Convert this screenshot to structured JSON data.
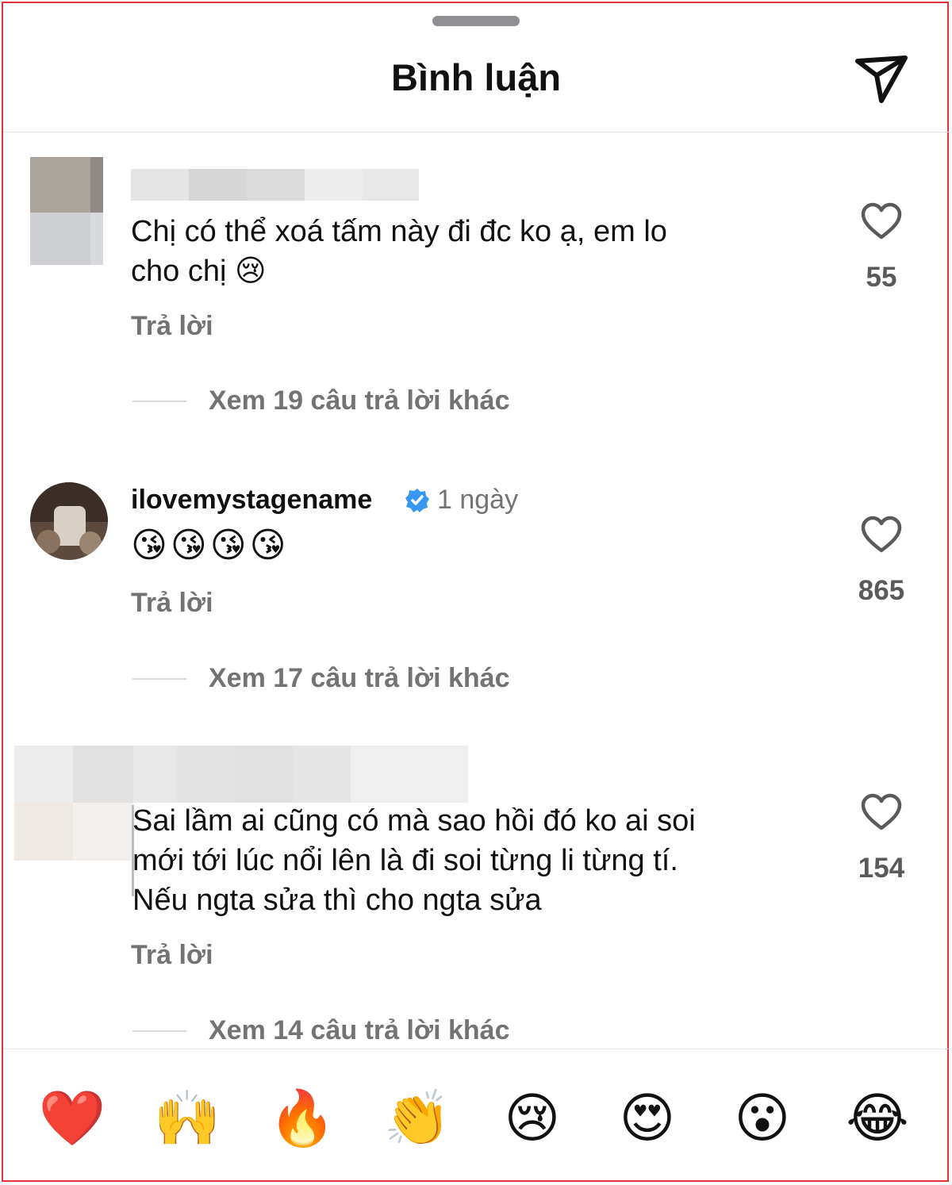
{
  "header": {
    "title": "Bình luận",
    "send_icon": "paper-plane-icon"
  },
  "comments": [
    {
      "username": "",
      "time": "",
      "text": "Chị có thể xoá tấm này đi đc ko ạ, em lo\ncho chị 😢",
      "likes": "55",
      "reply_label": "Trả lời",
      "more_replies": "Xem 19 câu trả lời khác"
    },
    {
      "username": "ilovemystagename",
      "verified": true,
      "time": "1 ngày",
      "text": "😘😘😘😘",
      "likes": "865",
      "reply_label": "Trả lời",
      "more_replies": "Xem 17 câu trả lời khác"
    },
    {
      "username": "",
      "time": "",
      "text": "Sai lầm ai cũng có mà sao hồi đó ko ai soi\nmới tới lúc nổi lên là đi soi từng li từng tí.\nNếu ngta sửa thì cho ngta sửa",
      "likes": "154",
      "reply_label": "Trả lời",
      "more_replies": "Xem 14 câu trả lời khác"
    }
  ],
  "reactions": [
    "❤️",
    "🙌",
    "🔥",
    "👏",
    "😢",
    "😍",
    "😮",
    "😂"
  ],
  "colors": {
    "accent_verified": "#3897f0",
    "muted_text": "#737373",
    "frame_border": "#e0333b"
  }
}
